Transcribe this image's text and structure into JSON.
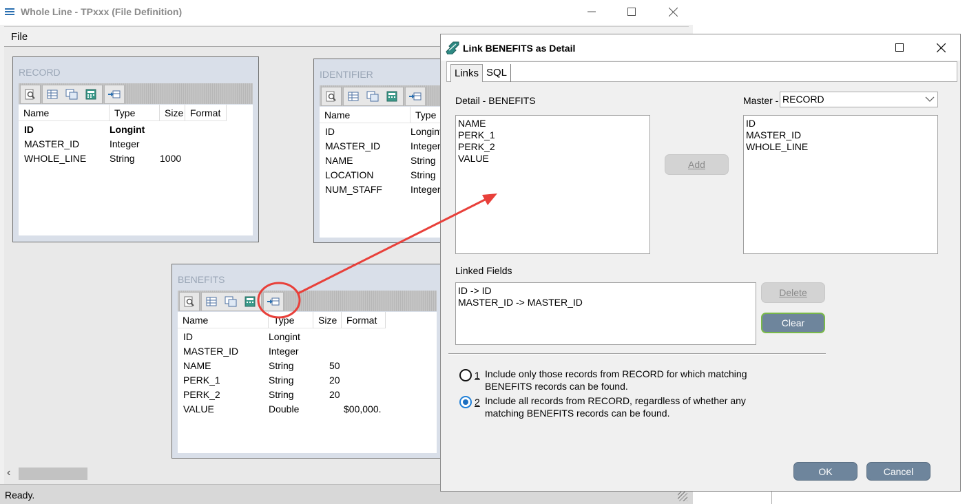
{
  "main_window": {
    "title": "Whole Line - TPxxx (File Definition)",
    "menu": {
      "file": "File"
    },
    "status": "Ready."
  },
  "panels": {
    "record": {
      "title": "RECORD",
      "columns": [
        "Name",
        "Type",
        "Size",
        "Format"
      ],
      "rows": [
        {
          "name": "ID",
          "type": "Longint",
          "size": "",
          "format": ""
        },
        {
          "name": "MASTER_ID",
          "type": "Integer",
          "size": "",
          "format": ""
        },
        {
          "name": "WHOLE_LINE",
          "type": "String",
          "size": "1000",
          "format": ""
        }
      ]
    },
    "identifier": {
      "title": "IDENTIFIER",
      "columns": [
        "Name",
        "Type"
      ],
      "rows": [
        {
          "name": "ID",
          "type": "Longint"
        },
        {
          "name": "MASTER_ID",
          "type": "Integer"
        },
        {
          "name": "NAME",
          "type": "String"
        },
        {
          "name": "LOCATION",
          "type": "String"
        },
        {
          "name": "NUM_STAFF",
          "type": "Integer"
        }
      ]
    },
    "benefits": {
      "title": "BENEFITS",
      "columns": [
        "Name",
        "Type",
        "Size",
        "Format"
      ],
      "rows": [
        {
          "name": "ID",
          "type": "Longint",
          "size": "",
          "format": ""
        },
        {
          "name": "MASTER_ID",
          "type": "Integer",
          "size": "",
          "format": ""
        },
        {
          "name": "NAME",
          "type": "String",
          "size": "50",
          "format": ""
        },
        {
          "name": "PERK_1",
          "type": "String",
          "size": "20",
          "format": ""
        },
        {
          "name": "PERK_2",
          "type": "String",
          "size": "20",
          "format": ""
        },
        {
          "name": "VALUE",
          "type": "Double",
          "size": "",
          "format": "$00,000."
        }
      ]
    }
  },
  "dialog": {
    "title": "Link BENEFITS as Detail",
    "tabs": [
      "Links",
      "SQL"
    ],
    "detail_label": "Detail - BENEFITS",
    "detail_fields": [
      "NAME",
      "PERK_1",
      "PERK_2",
      "VALUE"
    ],
    "master_label": "Master -",
    "master_selected": "RECORD",
    "master_fields": [
      "ID",
      "MASTER_ID",
      "WHOLE_LINE"
    ],
    "add_button": "Add",
    "linked_label": "Linked Fields",
    "linked_fields": [
      "ID -> ID",
      "MASTER_ID -> MASTER_ID"
    ],
    "delete_button": "Delete",
    "clear_button": "Clear",
    "option1_number": "1",
    "option1_text": "Include only those records from RECORD for which matching BENEFITS records can be found.",
    "option2_number": "2",
    "option2_text": "Include all records from RECORD, regardless of whether any matching BENEFITS records can be found.",
    "selected_option": 2,
    "ok_button": "OK",
    "cancel_button": "Cancel"
  },
  "colors": {
    "annotation_red": "#e8403a",
    "dark_button": "#6e859c",
    "clear_focus_border": "#79b84a",
    "panel_title": "#9aa6b6",
    "radio_selected": "#1e7fd8"
  }
}
